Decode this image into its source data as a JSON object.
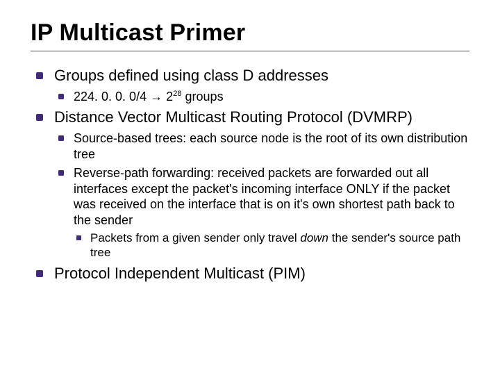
{
  "title": "IP Multicast Primer",
  "bullets": {
    "b1": "Groups defined using class D addresses",
    "b1a_prefix": "224. 0. 0. 0/4 ",
    "b1a_arrow": "→",
    "b1a_two": " 2",
    "b1a_exp": "28",
    "b1a_suffix": " groups",
    "b2": "Distance Vector Multicast Routing Protocol (DVMRP)",
    "b2a": "Source-based trees: each source node is the root of its own distribution tree",
    "b2b": "Reverse-path forwarding: received packets are forwarded out all interfaces except the packet's incoming interface ONLY if the packet was received on the interface that is on it's own shortest path back to the sender",
    "b2b1_pre": "Packets from a given sender only travel ",
    "b2b1_em": "down ",
    "b2b1_post": "the sender's source path tree",
    "b3": "Protocol Independent Multicast (PIM)"
  }
}
